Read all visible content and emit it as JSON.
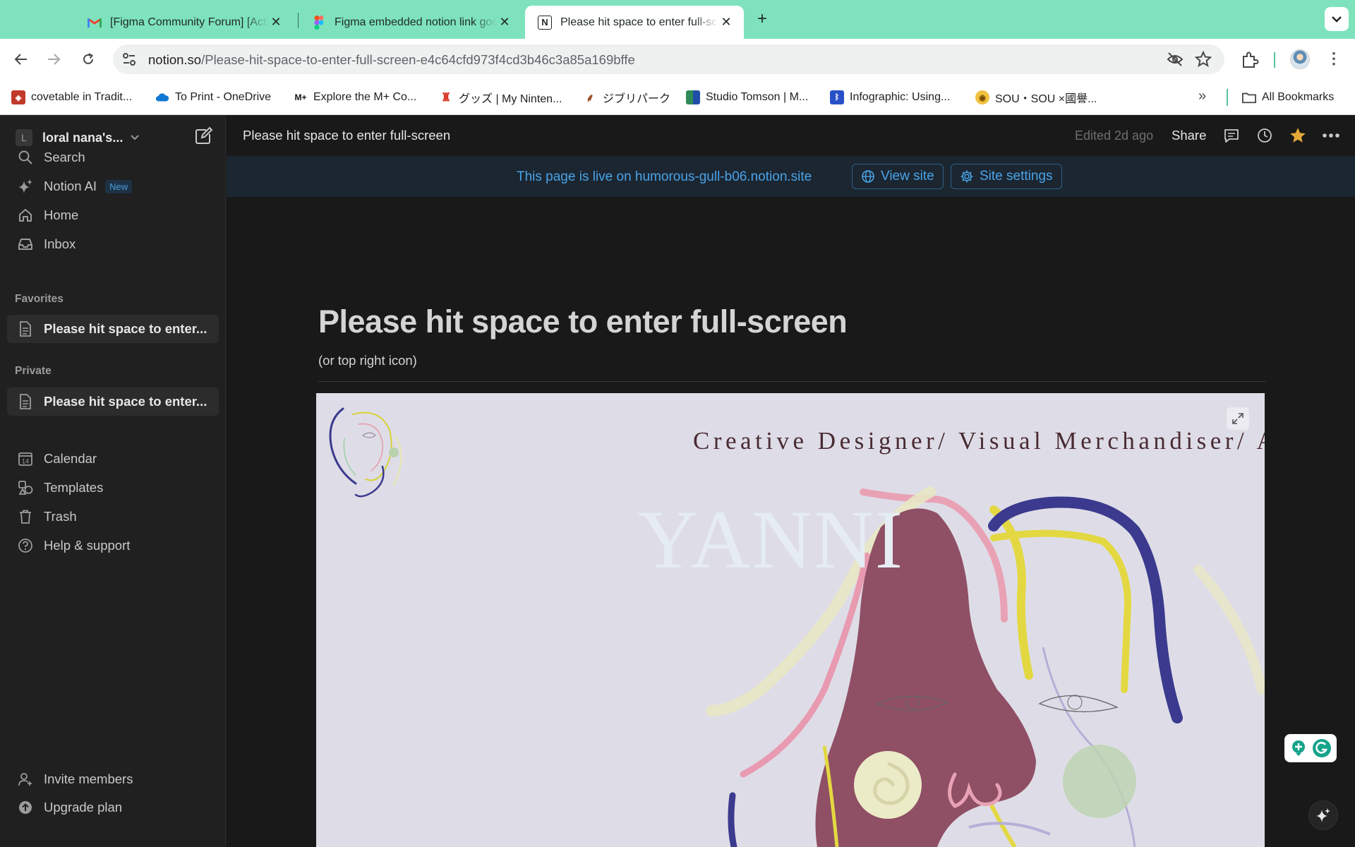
{
  "browser": {
    "tabs": [
      {
        "title": "[Figma Community Forum] [Action required]",
        "favicon": "gmail-icon",
        "active": false
      },
      {
        "title": "Figma embedded notion link goes",
        "favicon": "figma-icon",
        "active": false
      },
      {
        "title": "Please hit space to enter full-screen",
        "favicon": "notion-icon",
        "active": true
      }
    ],
    "new_tab_label": "+",
    "url_host": "notion.so",
    "url_path": "/Please-hit-space-to-enter-full-screen-e4c64cfd973f4cd3b46c3a85a169bffe",
    "bookmarks": [
      {
        "label": "covetable in Tradit...",
        "icon": "covetable-icon",
        "color": "#c0392b"
      },
      {
        "label": "To Print - OneDrive",
        "icon": "onedrive-icon",
        "color": "#0f78d4"
      },
      {
        "label": "Explore the M+ Co...",
        "icon": "mplus-icon",
        "color": "#111111"
      },
      {
        "label": "グッズ | My Ninten...",
        "icon": "mario-icon",
        "color": "#d73b2a"
      },
      {
        "label": "ジブリパーク",
        "icon": "ghibli-icon",
        "color": "#a0522d"
      },
      {
        "label": "Studio Tomson | M...",
        "icon": "tomson-icon",
        "color": "#2e8b57"
      },
      {
        "label": "Infographic: Using...",
        "icon": "infographic-icon",
        "color": "#2850c8"
      },
      {
        "label": "SOU・SOU ×國譽...",
        "icon": "sousou-icon",
        "color": "#e0a020"
      }
    ],
    "bookmarks_overflow": "»",
    "all_bookmarks": "All Bookmarks"
  },
  "sidebar": {
    "workspace_initial": "L",
    "workspace_name": "loral nana's...",
    "nav": [
      {
        "label": "Search",
        "icon": "search-icon"
      },
      {
        "label": "Notion AI",
        "icon": "sparkle-icon",
        "badge": "New"
      },
      {
        "label": "Home",
        "icon": "home-icon"
      },
      {
        "label": "Inbox",
        "icon": "inbox-icon"
      }
    ],
    "favorites_label": "Favorites",
    "favorites": [
      {
        "label": "Please hit space to enter..."
      }
    ],
    "private_label": "Private",
    "private": [
      {
        "label": "Please hit space to enter..."
      }
    ],
    "tools": [
      {
        "label": "Calendar",
        "icon": "calendar-icon",
        "day": "14"
      },
      {
        "label": "Templates",
        "icon": "templates-icon"
      },
      {
        "label": "Trash",
        "icon": "trash-icon"
      },
      {
        "label": "Help & support",
        "icon": "help-icon"
      }
    ],
    "footer": [
      {
        "label": "Invite members",
        "icon": "invite-icon"
      },
      {
        "label": "Upgrade plan",
        "icon": "upgrade-icon"
      }
    ]
  },
  "topbar": {
    "title": "Please hit space to enter full-screen",
    "edited": "Edited 2d ago",
    "share": "Share"
  },
  "banner": {
    "text": "This page is live on humorous-gull-b06.notion.site",
    "view_site": "View site",
    "site_settings": "Site settings"
  },
  "page": {
    "title": "Please hit space to enter full-screen",
    "subtitle": "(or top right icon)",
    "embed": {
      "heading": "Creative Designer/ Visual Merchandiser/ Art",
      "watermark": "YANNI"
    }
  },
  "colors": {
    "tabstrip": "#7ee3bd",
    "notion_bg": "#191919",
    "sidebar_bg": "#202020",
    "link_blue": "#4aa3e8",
    "favorite_star": "#e5a937",
    "embed_bg": "#dedde7"
  }
}
